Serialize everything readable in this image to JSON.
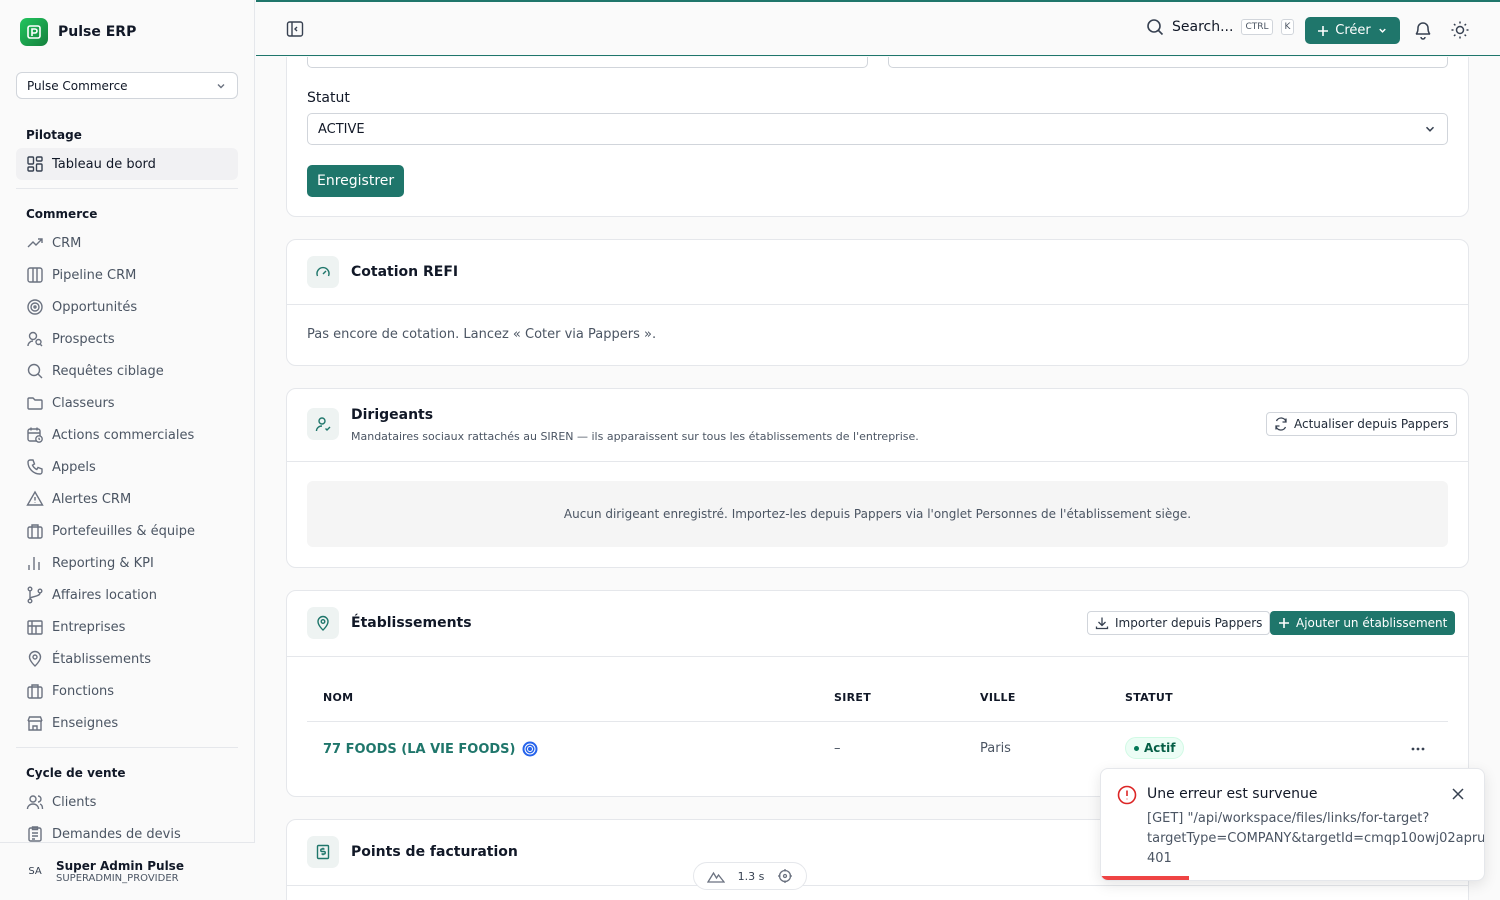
{
  "app": {
    "name": "Pulse ERP"
  },
  "org_select": {
    "value": "Pulse Commerce"
  },
  "sidebar": {
    "sections": [
      {
        "title": "Pilotage",
        "items": [
          {
            "label": "Tableau de bord",
            "icon": "dashboard-icon",
            "active": true
          }
        ]
      },
      {
        "title": "Commerce",
        "items": [
          {
            "label": "CRM",
            "icon": "trending-icon"
          },
          {
            "label": "Pipeline CRM",
            "icon": "columns-icon"
          },
          {
            "label": "Opportunités",
            "icon": "target-icon"
          },
          {
            "label": "Prospects",
            "icon": "user-search-icon"
          },
          {
            "label": "Requêtes ciblage",
            "icon": "search-icon"
          },
          {
            "label": "Classeurs",
            "icon": "folder-icon"
          },
          {
            "label": "Actions commerciales",
            "icon": "calendar-clock-icon"
          },
          {
            "label": "Appels",
            "icon": "phone-icon"
          },
          {
            "label": "Alertes CRM",
            "icon": "alert-icon"
          },
          {
            "label": "Portefeuilles & équipe",
            "icon": "briefcase-icon"
          },
          {
            "label": "Reporting & KPI",
            "icon": "bar-chart-icon"
          },
          {
            "label": "Affaires location",
            "icon": "git-branch-icon"
          },
          {
            "label": "Entreprises",
            "icon": "building-icon"
          },
          {
            "label": "Établissements",
            "icon": "map-pin-icon"
          },
          {
            "label": "Fonctions",
            "icon": "briefcase-icon"
          },
          {
            "label": "Enseignes",
            "icon": "store-icon"
          }
        ]
      },
      {
        "title": "Cycle de vente",
        "items": [
          {
            "label": "Clients",
            "icon": "users-icon"
          },
          {
            "label": "Demandes de devis",
            "icon": "clipboard-icon"
          }
        ]
      }
    ]
  },
  "user": {
    "initials": "SA",
    "name": "Super Admin Pulse",
    "role": "SUPERADMIN_PROVIDER"
  },
  "topbar": {
    "search_label": "Search...",
    "kbd_ctrl": "CTRL",
    "kbd_k": "K",
    "create_label": "Créer"
  },
  "form": {
    "statut_label": "Statut",
    "statut_value": "ACTIVE",
    "save_label": "Enregistrer"
  },
  "cotation": {
    "title": "Cotation REFI",
    "empty_text": "Pas encore de cotation. Lancez « Coter via Pappers »."
  },
  "dirigeants": {
    "title": "Dirigeants",
    "subtitle": "Mandataires sociaux rattachés au SIREN — ils apparaissent sur tous les établissements de l'entreprise.",
    "refresh_label": "Actualiser depuis Pappers",
    "empty_text": "Aucun dirigeant enregistré. Importez-les depuis Pappers via l'onglet Personnes de l'établissement siège."
  },
  "etablissements": {
    "title": "Établissements",
    "import_label": "Importer depuis Pappers",
    "add_label": "Ajouter un établissement",
    "columns": [
      "NOM",
      "SIRET",
      "VILLE",
      "STATUT"
    ],
    "rows": [
      {
        "nom": "77 FOODS (LA VIE FOODS)",
        "siret": "–",
        "ville": "Paris",
        "statut": "Actif"
      }
    ]
  },
  "facturation": {
    "title": "Points de facturation"
  },
  "toast": {
    "title": "Une erreur est survenue",
    "line1": "[GET] \"/api/workspace/files/links/for-target?",
    "line2": "targetType=COMPANY&targetId=cmqp10owj02apru",
    "line3": "401"
  },
  "devtools": {
    "timing": "1.3 s"
  },
  "colors": {
    "accent": "#1f766b",
    "error": "#ef4444",
    "success_bg": "#ecfdf5"
  }
}
